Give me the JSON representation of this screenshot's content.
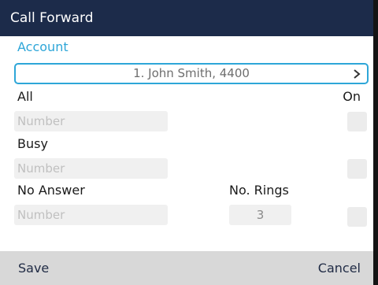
{
  "title": "Call Forward",
  "account": {
    "section_label": "Account",
    "selected": "1. John Smith, 4400"
  },
  "all": {
    "label": "All",
    "status": "On",
    "number_placeholder": "Number"
  },
  "busy": {
    "label": "Busy",
    "number_placeholder": "Number"
  },
  "no_answer": {
    "label": "No Answer",
    "rings_label": "No. Rings",
    "rings_value": "3",
    "number_placeholder": "Number"
  },
  "softkeys": {
    "save": "Save",
    "cancel": "Cancel"
  },
  "colors": {
    "title_bar": "#1c2b4a",
    "accent": "#2ea6d8",
    "softkey_bar": "#d8d8d8"
  },
  "icons": {
    "selector_arrow": "chevron-right-icon"
  }
}
